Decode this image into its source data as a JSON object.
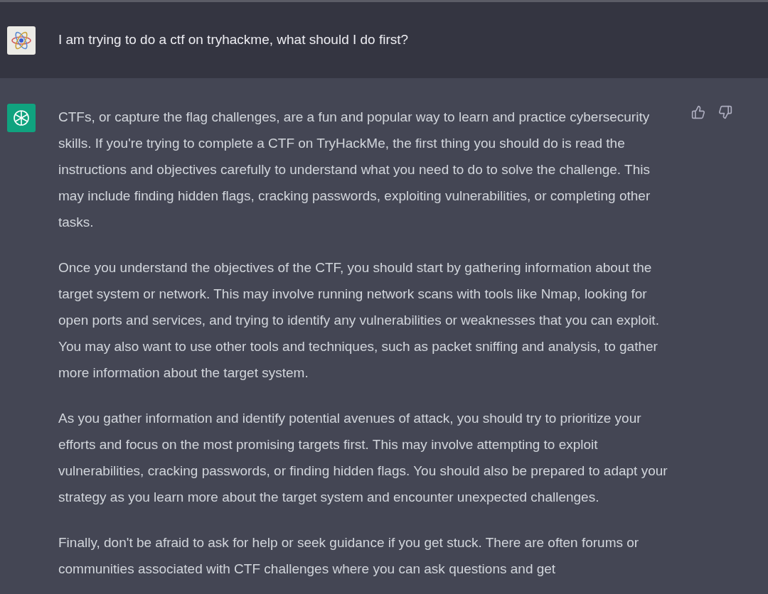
{
  "user_message": {
    "text": "I am trying to do a ctf on tryhackme, what should I do first?"
  },
  "assistant_message": {
    "paragraphs": [
      "CTFs, or capture the flag challenges, are a fun and popular way to learn and practice cybersecurity skills. If you're trying to complete a CTF on TryHackMe, the first thing you should do is read the instructions and objectives carefully to understand what you need to do to solve the challenge. This may include finding hidden flags, cracking passwords, exploiting vulnerabilities, or completing other tasks.",
      "Once you understand the objectives of the CTF, you should start by gathering information about the target system or network. This may involve running network scans with tools like Nmap, looking for open ports and services, and trying to identify any vulnerabilities or weaknesses that you can exploit. You may also want to use other tools and techniques, such as packet sniffing and analysis, to gather more information about the target system.",
      "As you gather information and identify potential avenues of attack, you should try to prioritize your efforts and focus on the most promising targets first. This may involve attempting to exploit vulnerabilities, cracking passwords, or finding hidden flags. You should also be prepared to adapt your strategy as you learn more about the target system and encounter unexpected challenges.",
      "Finally, don't be afraid to ask for help or seek guidance if you get stuck. There are often forums or communities associated with CTF challenges where you can ask questions and get"
    ]
  }
}
